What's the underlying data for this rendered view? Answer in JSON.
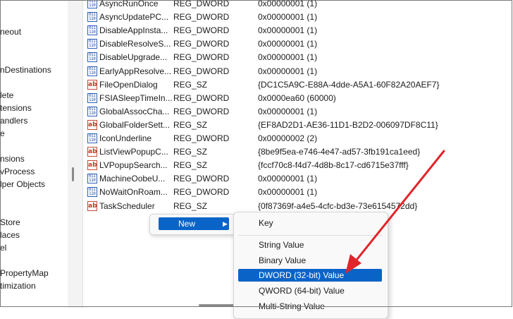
{
  "tree": {
    "items": [
      "neout",
      "nDestinations",
      "lete",
      "tensions",
      "andlers",
      "e",
      "nsions",
      "vProcess",
      "lper Objects",
      "",
      "Store",
      "laces",
      "el",
      "PropertyMap",
      "timization"
    ]
  },
  "values": {
    "rows": [
      {
        "name": "AsyncRunOnce",
        "type": "REG_DWORD",
        "data": "0x00000001 (1)",
        "icon": "binary-value-icon"
      },
      {
        "name": "AsyncUpdatePC...",
        "type": "REG_DWORD",
        "data": "0x00000001 (1)",
        "icon": "binary-value-icon"
      },
      {
        "name": "DisableAppInsta...",
        "type": "REG_DWORD",
        "data": "0x00000001 (1)",
        "icon": "binary-value-icon"
      },
      {
        "name": "DisableResolveS...",
        "type": "REG_DWORD",
        "data": "0x00000001 (1)",
        "icon": "binary-value-icon"
      },
      {
        "name": "DisableUpgrade...",
        "type": "REG_DWORD",
        "data": "0x00000001 (1)",
        "icon": "binary-value-icon"
      },
      {
        "name": "EarlyAppResolve...",
        "type": "REG_DWORD",
        "data": "0x00000001 (1)",
        "icon": "binary-value-icon"
      },
      {
        "name": "FileOpenDialog",
        "type": "REG_SZ",
        "data": "{DC1C5A9C-E88A-4dde-A5A1-60F82A20AEF7}",
        "icon": "string-value-icon"
      },
      {
        "name": "FSIASleepTimeIn...",
        "type": "REG_DWORD",
        "data": "0x0000ea60 (60000)",
        "icon": "binary-value-icon"
      },
      {
        "name": "GlobalAssocCha...",
        "type": "REG_DWORD",
        "data": "0x00000001 (1)",
        "icon": "binary-value-icon"
      },
      {
        "name": "GlobalFolderSett...",
        "type": "REG_SZ",
        "data": "{EF8AD2D1-AE36-11D1-B2D2-006097DF8C11}",
        "icon": "string-value-icon"
      },
      {
        "name": "IconUnderline",
        "type": "REG_DWORD",
        "data": "0x00000002 (2)",
        "icon": "binary-value-icon"
      },
      {
        "name": "ListViewPopupC...",
        "type": "REG_SZ",
        "data": "{8be9f5ea-e746-4e47-ad57-3fb191ca1eed}",
        "icon": "string-value-icon"
      },
      {
        "name": "LVPopupSearch...",
        "type": "REG_SZ",
        "data": "{fccf70c8-f4d7-4d8b-8c17-cd6715e37fff}",
        "icon": "string-value-icon"
      },
      {
        "name": "MachineOobeU...",
        "type": "REG_DWORD",
        "data": "0x00000001 (1)",
        "icon": "binary-value-icon"
      },
      {
        "name": "NoWaitOnRoam...",
        "type": "REG_DWORD",
        "data": "0x00000001 (1)",
        "icon": "binary-value-icon"
      },
      {
        "name": "TaskScheduler",
        "type": "REG_SZ",
        "data": "{0f87369f-a4e5-4cfc-bd3e-73e6154572dd}",
        "icon": "string-value-icon"
      }
    ]
  },
  "context_menu": {
    "new_label": "New",
    "new_arrow": "▶"
  },
  "submenu": {
    "key": "Key",
    "string_value": "String Value",
    "binary_value": "Binary Value",
    "dword_value": "DWORD (32-bit) Value",
    "qword_value": "QWORD (64-bit) Value",
    "multi_string_value": "Multi-String Value"
  },
  "colors": {
    "highlight": "#0a64c8",
    "annotation_arrow": "#e0242b"
  }
}
